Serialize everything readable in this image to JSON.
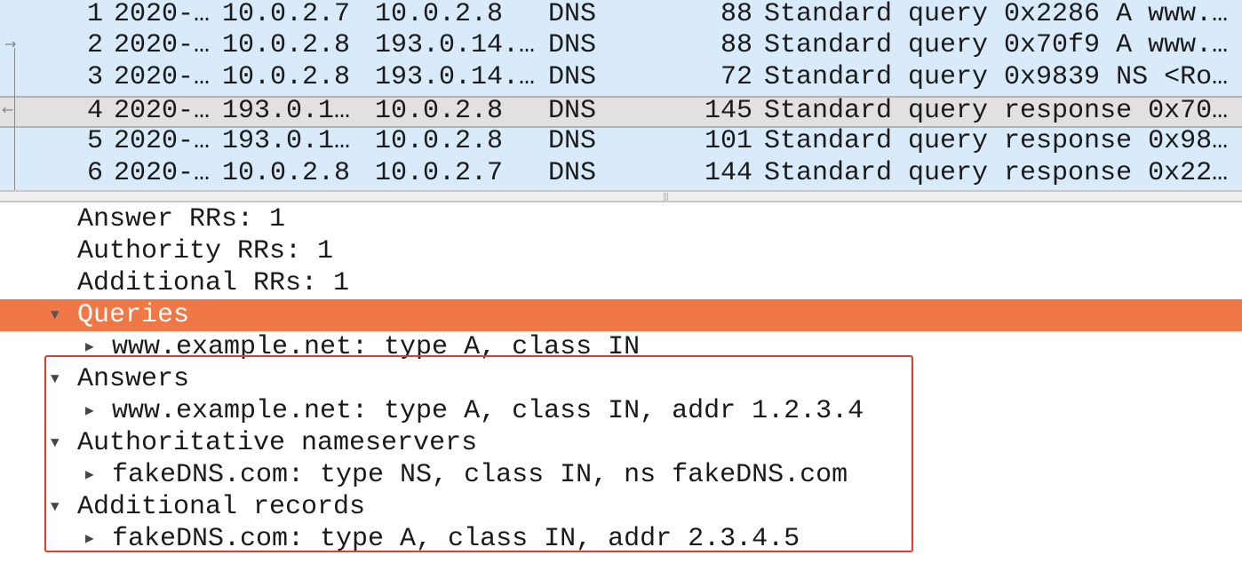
{
  "packets": [
    {
      "no": "1",
      "time": "2020-…",
      "src": "10.0.2.7",
      "dst": "10.0.2.8",
      "proto": "DNS",
      "len": "88",
      "info": "Standard query 0x2286 A www.…"
    },
    {
      "no": "2",
      "time": "2020-…",
      "src": "10.0.2.8",
      "dst": "193.0.14.…",
      "proto": "DNS",
      "len": "88",
      "info": "Standard query 0x70f9 A www.…"
    },
    {
      "no": "3",
      "time": "2020-…",
      "src": "10.0.2.8",
      "dst": "193.0.14.…",
      "proto": "DNS",
      "len": "72",
      "info": "Standard query 0x9839 NS <Ro…"
    },
    {
      "no": "4",
      "time": "2020-…",
      "src": "193.0.1…",
      "dst": "10.0.2.8",
      "proto": "DNS",
      "len": "145",
      "info": "Standard query response 0x70…",
      "selected": true
    },
    {
      "no": "5",
      "time": "2020-…",
      "src": "193.0.1…",
      "dst": "10.0.2.8",
      "proto": "DNS",
      "len": "101",
      "info": "Standard query response 0x98…"
    },
    {
      "no": "6",
      "time": "2020-…",
      "src": "10.0.2.8",
      "dst": "10.0.2.7",
      "proto": "DNS",
      "len": "144",
      "info": "Standard query response 0x22…"
    }
  ],
  "details": [
    {
      "text": "Answer RRs: 1",
      "level": 1
    },
    {
      "text": "Authority RRs: 1",
      "level": 1
    },
    {
      "text": "Additional RRs: 1",
      "level": 1
    },
    {
      "text": "Queries",
      "level": 0,
      "expanded": true,
      "highlight": true
    },
    {
      "text": "www.example.net: type A, class IN",
      "level": 1,
      "collapsed": true
    },
    {
      "text": "Answers",
      "level": 0,
      "expanded": true
    },
    {
      "text": "www.example.net: type A, class IN, addr 1.2.3.4",
      "level": 1,
      "collapsed": true
    },
    {
      "text": "Authoritative nameservers",
      "level": 0,
      "expanded": true
    },
    {
      "text": "fakeDNS.com: type NS, class IN, ns fakeDNS.com",
      "level": 1,
      "collapsed": true
    },
    {
      "text": "Additional records",
      "level": 0,
      "expanded": true
    },
    {
      "text": "fakeDNS.com: type A, class IN, addr 2.3.4.5",
      "level": 1,
      "collapsed": true
    }
  ],
  "colors": {
    "list_bg": "#d9ebfb",
    "highlight": "#f07846",
    "annotation_box": "#e53b2c"
  }
}
